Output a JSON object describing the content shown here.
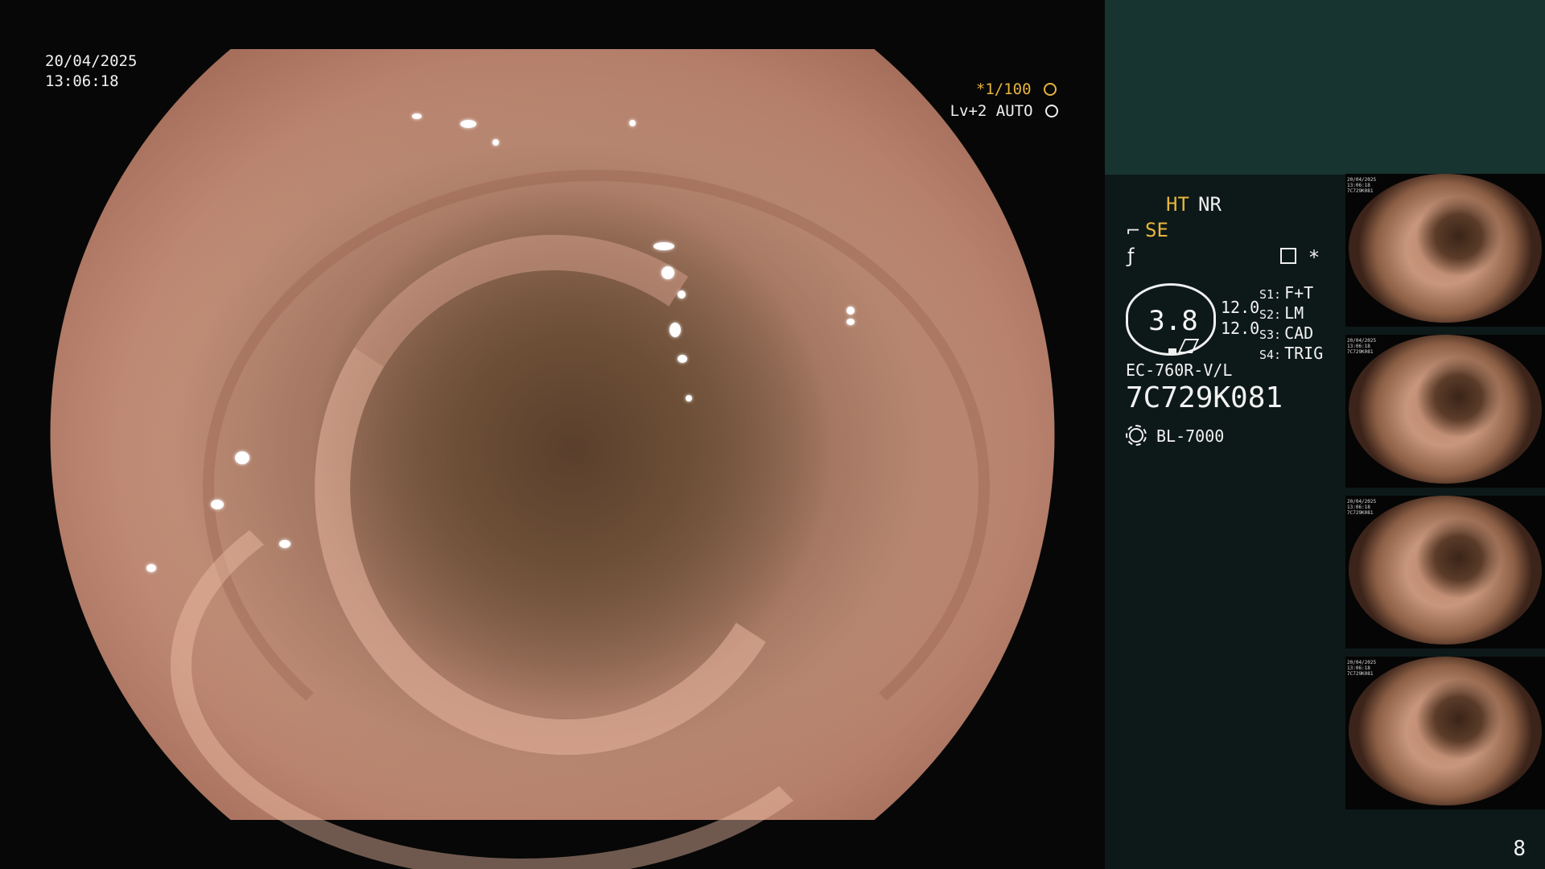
{
  "overlay": {
    "date": "20/04/2025",
    "time": "13:06:18",
    "zoom_label": "*1/100",
    "level_label": "Lv+2 AUTO"
  },
  "panel": {
    "modes": {
      "ht": "HT",
      "nr": "NR",
      "se": "SE"
    },
    "hex_value": "3.8",
    "values": [
      "12.0",
      "12.0"
    ],
    "switches": [
      {
        "prefix": "S1:",
        "label": "F+T"
      },
      {
        "prefix": "S2:",
        "label": "LM"
      },
      {
        "prefix": "S3:",
        "label": "CAD"
      },
      {
        "prefix": "S4:",
        "label": "TRIG"
      }
    ],
    "model": "EC-760R-V/L",
    "serial": "7C729K081",
    "light_source": "BL-7000",
    "star": "*"
  },
  "thumbnails": [
    {
      "date": "20/04/2025",
      "time": "13:06:18",
      "serial": "7C729K081"
    },
    {
      "date": "20/04/2025",
      "time": "13:06:18",
      "serial": "7C729K081"
    },
    {
      "date": "20/04/2025",
      "time": "13:06:18",
      "serial": "7C729K081"
    },
    {
      "date": "20/04/2025",
      "time": "13:06:18",
      "serial": "7C729K081"
    }
  ],
  "page_number": "8"
}
